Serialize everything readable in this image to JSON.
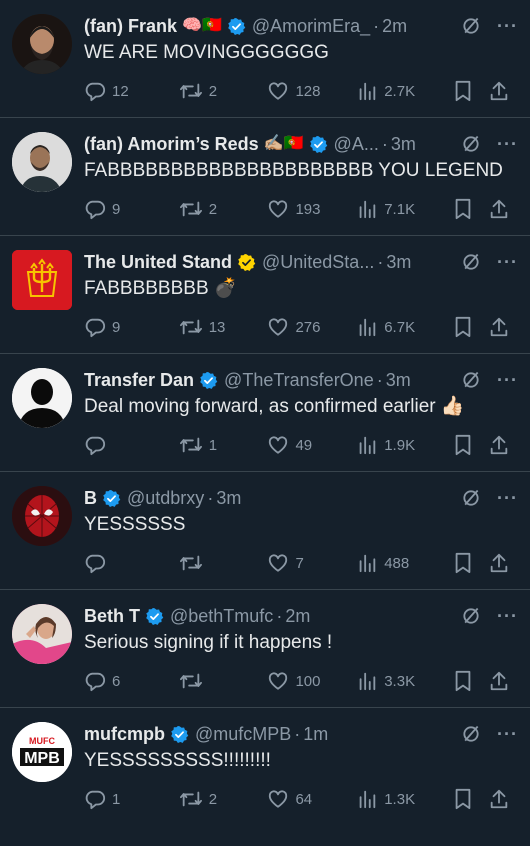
{
  "tweets": [
    {
      "name": "(fan) Frank",
      "emoji": "🧠🇵🇹",
      "verified": true,
      "verified_color": "#1d9bf0",
      "handle": "@AmorimEra_",
      "time": "2m",
      "text": "WE ARE MOVINGGGGGGG",
      "replies": "12",
      "retweets": "2",
      "likes": "128",
      "views": "2.7K",
      "avatar": "bearded-man-avatar"
    },
    {
      "name": "(fan) Amorim’s Reds",
      "emoji": "✍🏼🇵🇹",
      "verified": true,
      "verified_color": "#1d9bf0",
      "handle": "@A...",
      "time": "3m",
      "text": "FABBBBBBBBBBBBBBBBBBBBB YOU LEGEND",
      "replies": "9",
      "retweets": "2",
      "likes": "193",
      "views": "7.1K",
      "avatar": "man-portrait-avatar"
    },
    {
      "name": "The United Stand",
      "emoji": "",
      "verified": true,
      "verified_color": "#ffd400",
      "handle": "@UnitedSta...",
      "time": "3m",
      "text": "FABBBBBBBB 💣",
      "replies": "9",
      "retweets": "13",
      "likes": "276",
      "views": "6.7K",
      "avatar": "trident-crest-logo"
    },
    {
      "name": "Transfer Dan",
      "emoji": "",
      "verified": true,
      "verified_color": "#1d9bf0",
      "handle": "@TheTransferOne",
      "time": "3m",
      "text": "Deal moving forward, as confirmed earlier 👍🏻",
      "replies": "",
      "retweets": "1",
      "likes": "49",
      "views": "1.9K",
      "avatar": "silhouette-avatar"
    },
    {
      "name": "B",
      "emoji": "",
      "verified": true,
      "verified_color": "#1d9bf0",
      "handle": "@utdbrxy",
      "time": "3m",
      "text": "YESSSSSS",
      "replies": "",
      "retweets": "",
      "likes": "7",
      "views": "488",
      "avatar": "spiderman-avatar"
    },
    {
      "name": "Beth T",
      "emoji": "",
      "verified": true,
      "verified_color": "#1d9bf0",
      "handle": "@bethTmufc",
      "time": "2m",
      "text": "Serious signing if it happens !",
      "replies": "6",
      "retweets": "",
      "likes": "100",
      "views": "3.3K",
      "avatar": "woman-pink-avatar"
    },
    {
      "name": "mufcmpb",
      "emoji": "",
      "verified": true,
      "verified_color": "#1d9bf0",
      "handle": "@mufcMPB",
      "time": "1m",
      "text": "YESSSSSSSSS!!!!!!!!!",
      "replies": "1",
      "retweets": "2",
      "likes": "64",
      "views": "1.3K",
      "avatar": "mufc-mpb-logo"
    }
  ],
  "logos": {
    "mpb_top": "MUFC",
    "mpb_main": "MPB"
  },
  "colors": {
    "background": "#15202b",
    "text": "#e7e9ea",
    "muted": "#8b98a5",
    "divider": "#38444d"
  }
}
